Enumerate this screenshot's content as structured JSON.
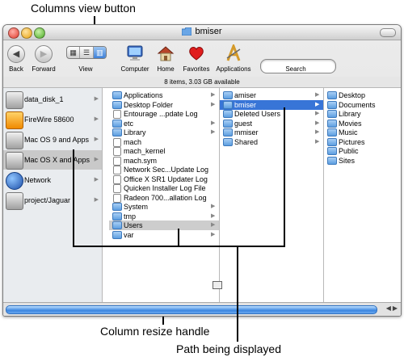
{
  "callouts": {
    "columns_view": "Columns view button",
    "resize_handle": "Column resize handle",
    "path": "Path being displayed"
  },
  "window": {
    "title": "bmiser",
    "status": "8 items, 3.03 GB available"
  },
  "toolbar": {
    "back": "Back",
    "forward": "Forward",
    "view": "View",
    "computer": "Computer",
    "home": "Home",
    "favorites": "Favorites",
    "applications": "Applications",
    "search": "Search"
  },
  "sidebar": [
    {
      "label": "data_disk_1",
      "icon": "disk-icon"
    },
    {
      "label": "FireWire 58600",
      "icon": "firewire-disk-icon"
    },
    {
      "label": "Mac OS 9 and Apps",
      "icon": "disk-icon"
    },
    {
      "label": "Mac OS X and Apps",
      "icon": "disk-icon",
      "selected": true
    },
    {
      "label": "Network",
      "icon": "network-globe-icon"
    },
    {
      "label": "project/Jaguar",
      "icon": "disk-icon"
    }
  ],
  "col1": [
    {
      "label": "Applications",
      "type": "folder",
      "arrow": true
    },
    {
      "label": "Desktop Folder",
      "type": "folder",
      "arrow": true
    },
    {
      "label": "Entourage ...pdate Log",
      "type": "doc"
    },
    {
      "label": "etc",
      "type": "folder",
      "arrow": true
    },
    {
      "label": "Library",
      "type": "folder",
      "arrow": true
    },
    {
      "label": "mach",
      "type": "doc"
    },
    {
      "label": "mach_kernel",
      "type": "doc"
    },
    {
      "label": "mach.sym",
      "type": "doc"
    },
    {
      "label": "Network Sec...Update Log",
      "type": "doc"
    },
    {
      "label": "Office X SR1 Updater Log",
      "type": "doc"
    },
    {
      "label": "Quicken Installer Log File",
      "type": "doc"
    },
    {
      "label": "Radeon 700...allation Log",
      "type": "doc"
    },
    {
      "label": "System",
      "type": "folder",
      "arrow": true
    },
    {
      "label": "tmp",
      "type": "folder",
      "arrow": true
    },
    {
      "label": "Users",
      "type": "folder",
      "arrow": true,
      "highlight": true
    },
    {
      "label": "var",
      "type": "folder",
      "arrow": true
    }
  ],
  "col2": [
    {
      "label": "amiser",
      "type": "folder",
      "arrow": true
    },
    {
      "label": "bmiser",
      "type": "folder",
      "arrow": true,
      "active": true
    },
    {
      "label": "Deleted Users",
      "type": "folder",
      "arrow": true
    },
    {
      "label": "guest",
      "type": "folder",
      "arrow": true
    },
    {
      "label": "mmiser",
      "type": "folder",
      "arrow": true
    },
    {
      "label": "Shared",
      "type": "folder",
      "arrow": true
    }
  ],
  "col3": [
    {
      "label": "Desktop",
      "type": "folder"
    },
    {
      "label": "Documents",
      "type": "folder"
    },
    {
      "label": "Library",
      "type": "folder"
    },
    {
      "label": "Movies",
      "type": "folder"
    },
    {
      "label": "Music",
      "type": "folder"
    },
    {
      "label": "Pictures",
      "type": "folder"
    },
    {
      "label": "Public",
      "type": "folder"
    },
    {
      "label": "Sites",
      "type": "folder"
    }
  ],
  "icons": {
    "back": "arrow-left-icon",
    "forward": "arrow-right-icon",
    "computer": "monitor-icon",
    "home": "house-icon",
    "favorites": "heart-icon",
    "applications": "applications-a-icon"
  }
}
